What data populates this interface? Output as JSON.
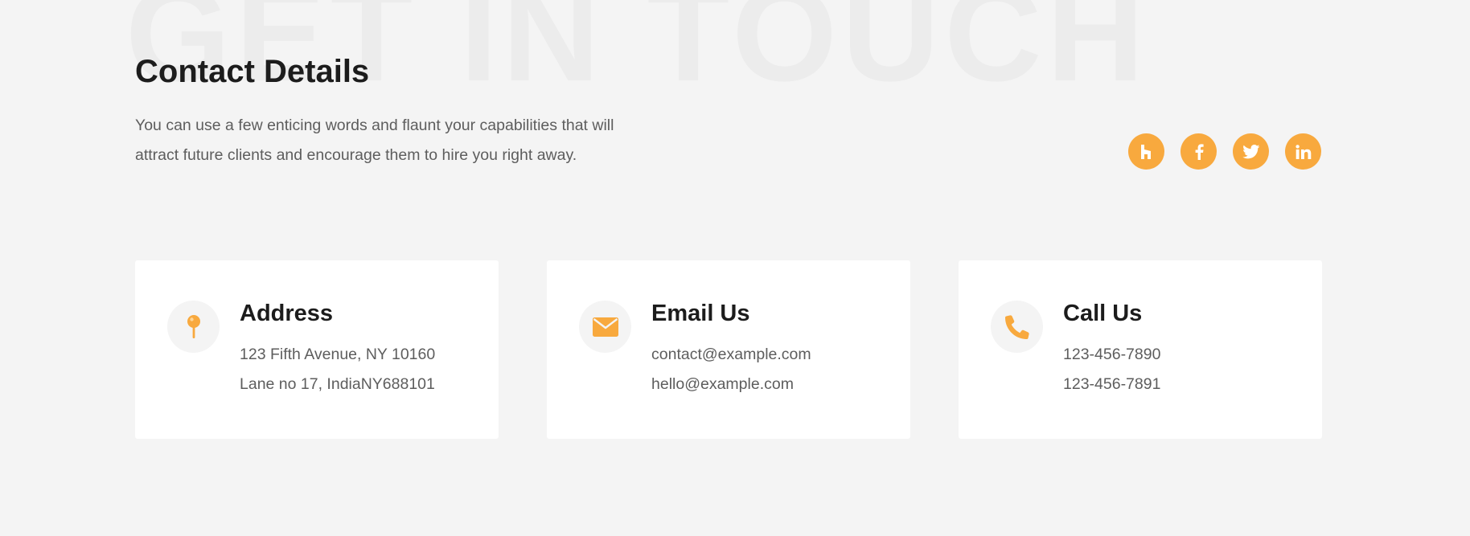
{
  "section": {
    "watermark": "GET IN TOUCH",
    "title": "Contact Details",
    "intro_line1": "You can use a few enticing words and flaunt your capabilities that will",
    "intro_line2": "attract future clients and encourage them to hire you right away."
  },
  "social": [
    {
      "name": "houzz",
      "icon": "houzz-icon"
    },
    {
      "name": "facebook",
      "icon": "facebook-icon"
    },
    {
      "name": "twitter",
      "icon": "twitter-icon"
    },
    {
      "name": "linkedin",
      "icon": "linkedin-icon"
    }
  ],
  "cards": [
    {
      "title": "Address",
      "icon": "map-pin-icon",
      "lines": [
        "123 Fifth Avenue, NY 10160",
        "Lane no 17, IndiaNY688101"
      ]
    },
    {
      "title": "Email Us",
      "icon": "envelope-icon",
      "lines": [
        "contact@example.com",
        "hello@example.com"
      ]
    },
    {
      "title": "Call Us",
      "icon": "phone-icon",
      "lines": [
        "123-456-7890",
        "123-456-7891"
      ]
    }
  ],
  "colors": {
    "accent": "#f8a93e",
    "background": "#f4f4f4",
    "card": "#ffffff",
    "heading": "#1c1c1c",
    "body_text": "#5d5d5d",
    "watermark": "#ececec"
  }
}
